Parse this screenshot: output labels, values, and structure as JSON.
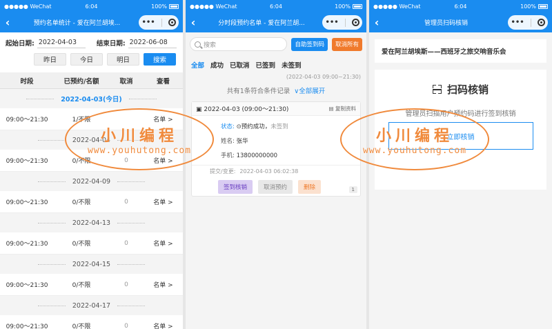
{
  "status_bar": {
    "carrier": "●●●●● WeChat",
    "time": "6:04",
    "battery": "100%"
  },
  "screen1": {
    "title": "预约名单统计 - 爱在阿兰胡埃...",
    "start_label": "起始日期:",
    "start_value": "2022-04-03",
    "end_label": "结束日期:",
    "end_value": "2022-06-08",
    "buttons": {
      "yesterday": "昨日",
      "today": "今日",
      "tomorrow": "明日",
      "search": "搜索"
    },
    "columns": [
      "时段",
      "已预约/名额",
      "取消",
      "查看"
    ],
    "groups": [
      {
        "date": "2022-04-03(今日)",
        "time": "09:00～21:30",
        "booked": "1/不限",
        "cancel": "",
        "view": "名单 >"
      },
      {
        "date": "2022-04-04",
        "time": "09:00～21:30",
        "booked": "0/不限",
        "cancel": "0",
        "view": "名单 >"
      },
      {
        "date": "2022-04-09",
        "time": "09:00～21:30",
        "booked": "0/不限",
        "cancel": "0",
        "view": "名单 >"
      },
      {
        "date": "2022-04-13",
        "time": "09:00～21:30",
        "booked": "0/不限",
        "cancel": "0",
        "view": "名单 >"
      },
      {
        "date": "2022-04-15",
        "time": "09:00～21:30",
        "booked": "0/不限",
        "cancel": "0",
        "view": "名单 >"
      },
      {
        "date": "2022-04-17",
        "time": "09:00～21:30",
        "booked": "0/不限",
        "cancel": "0",
        "view": "名单 >"
      }
    ]
  },
  "screen2": {
    "title": "分时段预约名单 - 爱在阿兰胡...",
    "search_placeholder": "搜索",
    "self_checkin": "自助签到码",
    "cancel_all": "取消所有",
    "tabs": [
      "全部",
      "成功",
      "已取消",
      "已签到",
      "未签到"
    ],
    "range": "(2022-04-03 09:00~21:30)",
    "summary": "共有1条符合条件记录",
    "expand_all": "∨全部展开",
    "card": {
      "slot": "2022-04-03 (09:00～21:30)",
      "copy": "复制资料",
      "status_label": "状态:",
      "status_value": "⊙预约成功，",
      "status_extra": "未签到",
      "name_label": "姓名:",
      "name_value": "张华",
      "phone_label": "手机:",
      "phone_value": "13800000000",
      "submit_label": "提交/变更:",
      "submit_value": "2022-04-03 06:02:38",
      "btn_checkin": "签到核销",
      "btn_cancel": "取消预约",
      "btn_delete": "删除",
      "page": "1"
    }
  },
  "screen3": {
    "title": "管理员扫码核销",
    "event": "爱在阿兰胡埃斯——西班牙之旅交响音乐会",
    "scan_title": "扫码核销",
    "desc": "管理员扫描用户预约码进行签到核销",
    "btn": "立即核销"
  },
  "watermark": {
    "cn": "小川编程",
    "en": "www.youhutong.com"
  },
  "colors": {
    "primary": "#1a8cf0",
    "orange": "#f08a3c",
    "purple": "#6a3fc2"
  }
}
